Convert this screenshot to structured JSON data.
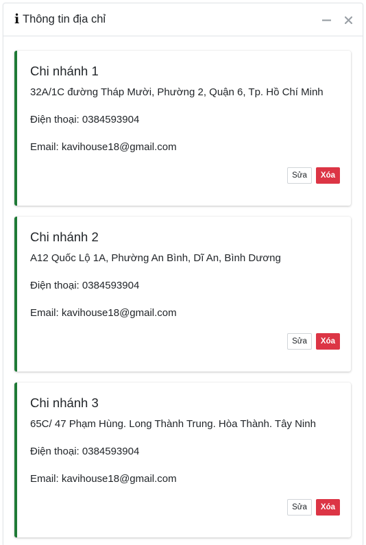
{
  "header": {
    "title": "Thông tin địa chỉ",
    "info_icon": "i",
    "minimize_icon": "minus-icon",
    "close_icon": "close-icon"
  },
  "colors": {
    "accent": "#1e7a36",
    "danger": "#dc3545",
    "tool_icon": "#9aa0a6"
  },
  "branches": [
    {
      "name": "Chi nhánh 1",
      "address": "32A/1C đường Tháp Mười, Phường 2, Quận 6, Tp. Hồ Chí Minh",
      "phone": "Điện thoại: 0384593904",
      "email": "Email: kavihouse18@gmail.com",
      "edit_label": "Sửa",
      "delete_label": "Xóa"
    },
    {
      "name": "Chi nhánh 2",
      "address": "A12 Quốc Lộ 1A, Phường An Bình, Dĩ An, Bình Dương",
      "phone": "Điện thoại: 0384593904",
      "email": "Email: kavihouse18@gmail.com",
      "edit_label": "Sửa",
      "delete_label": "Xóa"
    },
    {
      "name": "Chi nhánh 3",
      "address": "65C/ 47 Phạm Hùng. Long Thành Trung. Hòa Thành. Tây Ninh",
      "phone": "Điện thoại: 0384593904",
      "email": "Email: kavihouse18@gmail.com",
      "edit_label": "Sửa",
      "delete_label": "Xóa"
    }
  ]
}
